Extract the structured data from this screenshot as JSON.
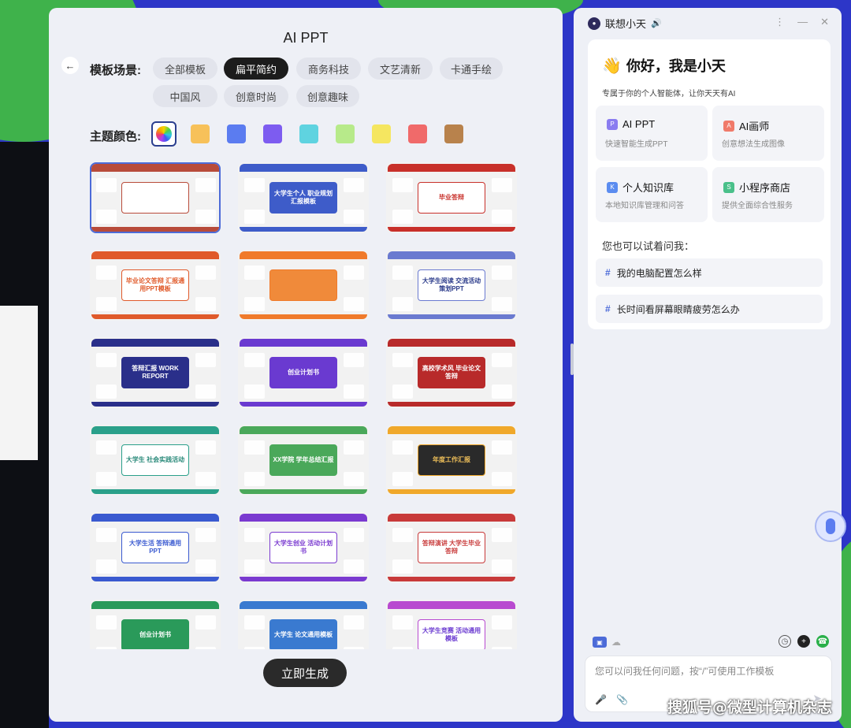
{
  "left_window": {
    "title": "AI PPT",
    "scene_label": "模板场景:",
    "scene_chips": [
      {
        "label": "全部模板",
        "active": false
      },
      {
        "label": "扁平简约",
        "active": true
      },
      {
        "label": "商务科技",
        "active": false
      },
      {
        "label": "文艺清新",
        "active": false
      },
      {
        "label": "卡通手绘",
        "active": false
      },
      {
        "label": "中国风",
        "active": false
      },
      {
        "label": "创意时尚",
        "active": false
      },
      {
        "label": "创意趣味",
        "active": false
      }
    ],
    "color_label": "主题颜色:",
    "theme_colors": [
      "#f7c15a",
      "#5b7cf0",
      "#7d5cf0",
      "#5fd3e0",
      "#b7ea8a",
      "#f5e660",
      "#f06a6a",
      "#b8824c"
    ],
    "templates": [
      {
        "text": "",
        "band": "#b84b3a",
        "card": "#ffffff",
        "ink": "#b84b3a",
        "selected": true
      },
      {
        "text": "大学生个人 职业规划汇报模板",
        "band": "#3e5cc9",
        "card": "#3e5cc9",
        "ink": "#ffffff",
        "selected": false
      },
      {
        "text": "毕业答辩",
        "band": "#c8302a",
        "card": "#ffffff",
        "ink": "#c8302a",
        "selected": false
      },
      {
        "text": "毕业论文答辩 汇报通用PPT模板",
        "band": "#e05a2a",
        "card": "#ffffff",
        "ink": "#e05a2a",
        "selected": false
      },
      {
        "text": "",
        "band": "#f07a2a",
        "card": "#f08a3a",
        "ink": "#ffffff",
        "selected": false
      },
      {
        "text": "大学生阅读 交流活动策划PPT",
        "band": "#6a7ad0",
        "card": "#ffffff",
        "ink": "#2a3a8a",
        "selected": false
      },
      {
        "text": "答辩汇报 WORK REPORT",
        "band": "#2a2f8a",
        "card": "#2a2f8a",
        "ink": "#ffffff",
        "selected": false
      },
      {
        "text": "创业计划书",
        "band": "#6a3ad0",
        "card": "#6a3ad0",
        "ink": "#ffffff",
        "selected": false
      },
      {
        "text": "高校学术风 毕业论文答辩",
        "band": "#b82a2a",
        "card": "#b82a2a",
        "ink": "#ffffff",
        "selected": false
      },
      {
        "text": "大学生 社会实践活动",
        "band": "#2aa08a",
        "card": "#ffffff",
        "ink": "#2a8a7a",
        "selected": false
      },
      {
        "text": "XX学院 学年总结汇报",
        "band": "#4aa85a",
        "card": "#4aa85a",
        "ink": "#ffffff",
        "selected": false
      },
      {
        "text": "年度工作汇报",
        "band": "#f0a82a",
        "card": "#2a2a2a",
        "ink": "#f0c05a",
        "selected": false
      },
      {
        "text": "大学生活 答辩通用PPT",
        "band": "#3a5ad0",
        "card": "#ffffff",
        "ink": "#3a5ad0",
        "selected": false
      },
      {
        "text": "大学生创业 活动计划书",
        "band": "#7a3ad0",
        "card": "#ffffff",
        "ink": "#7a3ad0",
        "selected": false
      },
      {
        "text": "答辩演讲 大学生毕业答辩",
        "band": "#c83a3a",
        "card": "#ffffff",
        "ink": "#c83a3a",
        "selected": false
      },
      {
        "text": "创业计划书",
        "band": "#2a9a5a",
        "card": "#2a9a5a",
        "ink": "#ffffff",
        "selected": false
      },
      {
        "text": "大学生 论文通用模板",
        "band": "#3a7ad0",
        "card": "#3a7ad0",
        "ink": "#ffffff",
        "selected": false
      },
      {
        "text": "大学生竞赛 活动通用模板",
        "band": "#b84ad0",
        "card": "#ffffff",
        "ink": "#6a3ad0",
        "selected": false
      }
    ],
    "generate_label": "立即生成"
  },
  "assistant": {
    "name": "联想小天",
    "greeting": "你好，我是小天",
    "subtitle": "专属于你的个人智能体，让你天天有AI",
    "features": [
      {
        "title": "AI PPT",
        "sub": "快速智能生成PPT",
        "icon": "ppt-icon",
        "color": "#8a7cf0"
      },
      {
        "title": "AI画师",
        "sub": "创意想法生成图像",
        "icon": "painter-icon",
        "color": "#f07a6a"
      },
      {
        "title": "个人知识库",
        "sub": "本地知识库管理和问答",
        "icon": "knowledge-base-icon",
        "color": "#5b8cf0"
      },
      {
        "title": "小程序商店",
        "sub": "提供全面综合性服务",
        "icon": "mini-app-store-icon",
        "color": "#4ac08a"
      }
    ],
    "try_label": "您也可以试着问我：",
    "suggestions": [
      "我的电脑配置怎么样",
      "长时间看屏幕眼睛疲劳怎么办"
    ],
    "input_placeholder": "您可以问我任何问题，按“/”可使用工作模板"
  },
  "watermark": "搜狐号@微型计算机杂志"
}
